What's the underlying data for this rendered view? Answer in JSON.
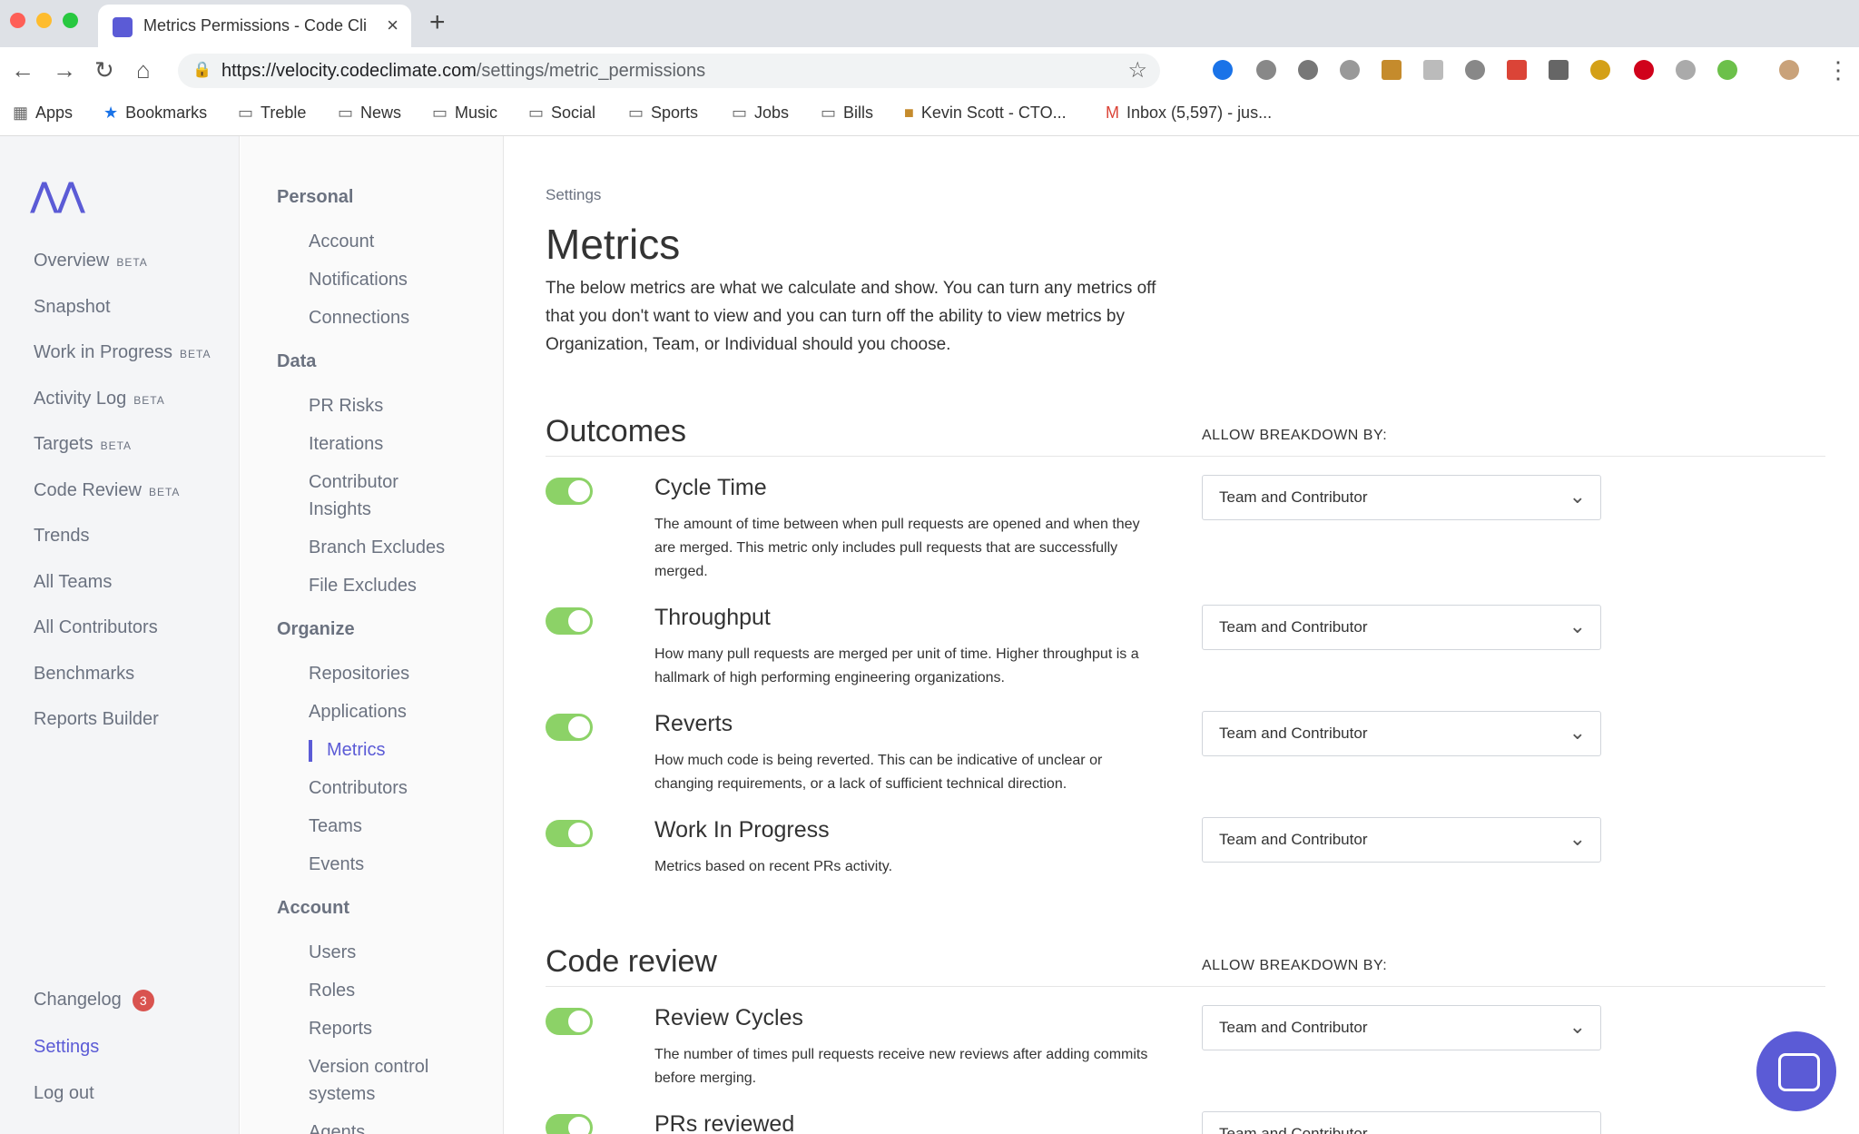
{
  "browser": {
    "tab_title": "Metrics Permissions - Code Cli",
    "url_host": "https://velocity.codeclimate.com",
    "url_path": "/settings/metric_permissions",
    "bookmarks": [
      "Apps",
      "Bookmarks",
      "Treble",
      "News",
      "Music",
      "Social",
      "Sports",
      "Jobs",
      "Bills",
      "Kevin Scott - CTO...",
      "Inbox (5,597) - jus..."
    ]
  },
  "leftnav": {
    "items": [
      {
        "label": "Overview",
        "beta": "BETA"
      },
      {
        "label": "Snapshot",
        "beta": ""
      },
      {
        "label": "Work in Progress",
        "beta": "BETA"
      },
      {
        "label": "Activity Log",
        "beta": "BETA"
      },
      {
        "label": "Targets",
        "beta": "BETA"
      },
      {
        "label": "Code Review",
        "beta": "BETA"
      },
      {
        "label": "Trends",
        "beta": ""
      },
      {
        "label": "All Teams",
        "beta": ""
      },
      {
        "label": "All Contributors",
        "beta": ""
      },
      {
        "label": "Benchmarks",
        "beta": ""
      },
      {
        "label": "Reports Builder",
        "beta": ""
      }
    ],
    "changelog": "Changelog",
    "changelog_count": "3",
    "settings": "Settings",
    "logout": "Log out"
  },
  "settingsnav": {
    "personal": "Personal",
    "personal_items": [
      "Account",
      "Notifications",
      "Connections"
    ],
    "data": "Data",
    "data_items": [
      "PR Risks",
      "Iterations",
      "Contributor Insights",
      "Branch Excludes",
      "File Excludes"
    ],
    "organize": "Organize",
    "organize_items": [
      "Repositories",
      "Applications",
      "Metrics",
      "Contributors",
      "Teams",
      "Events"
    ],
    "account": "Account",
    "account_items": [
      "Users",
      "Roles",
      "Reports",
      "Version control systems",
      "Agents"
    ]
  },
  "main": {
    "breadcrumb": "Settings",
    "title": "Metrics",
    "intro": "The below metrics are what we calculate and show. You can turn any metrics off that you don't want to view and you can turn off the ability to view metrics by Organization, Team, or Individual should you choose.",
    "allow_label": "ALLOW BREAKDOWN BY:",
    "sections": [
      {
        "title": "Outcomes",
        "metrics": [
          {
            "name": "Cycle Time",
            "desc": "The amount of time between when pull requests are opened and when they are merged. This metric only includes pull requests that are successfully merged.",
            "breakdown": "Team and Contributor"
          },
          {
            "name": "Throughput",
            "desc": "How many pull requests are merged per unit of time. Higher throughput is a hallmark of high performing engineering organizations.",
            "breakdown": "Team and Contributor"
          },
          {
            "name": "Reverts",
            "desc": "How much code is being reverted. This can be indicative of unclear or changing requirements, or a lack of sufficient technical direction.",
            "breakdown": "Team and Contributor"
          },
          {
            "name": "Work In Progress",
            "desc": "Metrics based on recent PRs activity.",
            "breakdown": "Team and Contributor"
          }
        ]
      },
      {
        "title": "Code review",
        "metrics": [
          {
            "name": "Review Cycles",
            "desc": "The number of times pull requests receive new reviews after adding commits before merging.",
            "breakdown": "Team and Contributor"
          },
          {
            "name": "PRs reviewed",
            "desc": "",
            "breakdown": "Team and Contributor"
          }
        ]
      }
    ]
  }
}
